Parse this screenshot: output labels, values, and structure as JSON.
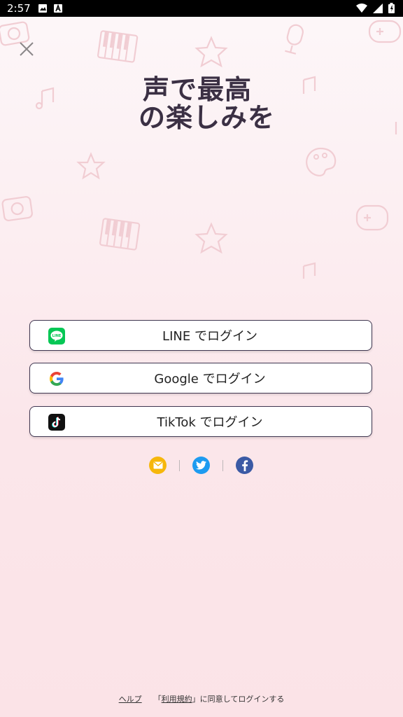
{
  "status_bar": {
    "time": "2:57"
  },
  "logo": {
    "line1": "声で最高",
    "line2": "の楽しみを"
  },
  "buttons": {
    "line": "LINE でログイン",
    "google": "Google でログイン",
    "tiktok": "TikTok でログイン"
  },
  "icons": {
    "line_logo": "line-logo",
    "google_logo": "google-logo",
    "tiktok_logo": "tiktok-logo",
    "mail": "mail-icon",
    "twitter": "twitter-icon",
    "facebook": "facebook-icon"
  },
  "colors": {
    "line": "#06c755",
    "mail": "#f6b70b",
    "twitter": "#1d9bf0",
    "facebook": "#3b5aa5"
  },
  "footer": {
    "help": "ヘルプ",
    "terms_open": "「",
    "terms": "利用規約",
    "terms_close": "」",
    "agree_text": "に同意してログインする"
  }
}
